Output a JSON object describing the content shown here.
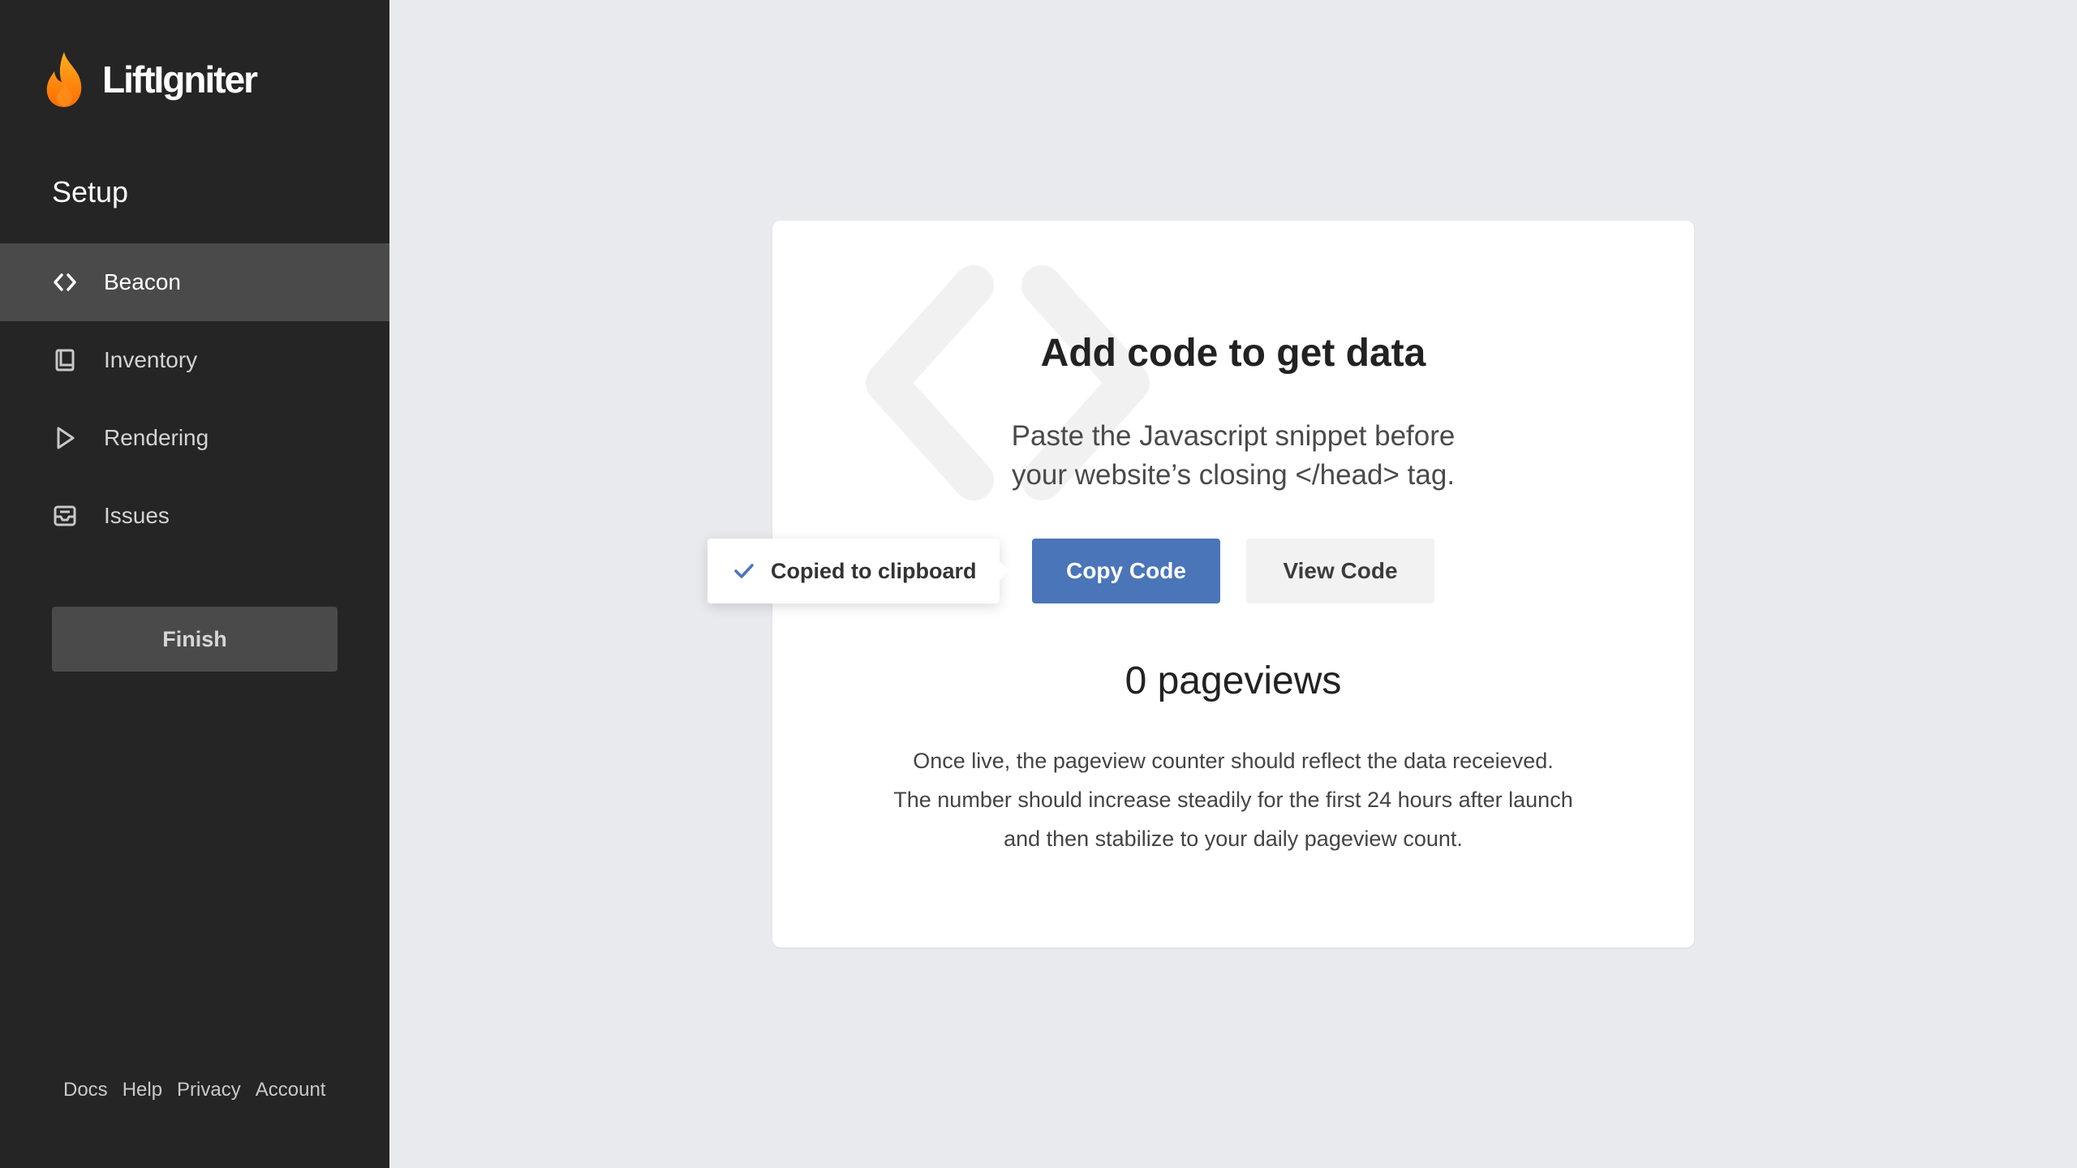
{
  "app": {
    "name": "LiftIgniter",
    "logo_icon": "flame-icon",
    "accent_color": "#4a75b9"
  },
  "sidebar": {
    "section_title": "Setup",
    "items": [
      {
        "label": "Beacon",
        "icon": "code-brackets-icon",
        "active": true
      },
      {
        "label": "Inventory",
        "icon": "book-icon",
        "active": false
      },
      {
        "label": "Rendering",
        "icon": "play-icon",
        "active": false
      },
      {
        "label": "Issues",
        "icon": "inbox-icon",
        "active": false
      }
    ],
    "finish_label": "Finish",
    "footer_links": [
      "Docs",
      "Help",
      "Privacy",
      "Account"
    ]
  },
  "card": {
    "title": "Add code to get data",
    "subtitle_lines": [
      "Paste the Javascript snippet before",
      "your website’s closing </head> tag."
    ],
    "copy_button_label": "Copy Code",
    "view_button_label": "View Code",
    "pageviews_text": "0 pageviews",
    "note_lines": [
      "Once live, the pageview counter should reflect the data receieved.",
      "The number should increase steadily for the first 24 hours after launch",
      "and then stabilize to your daily pageview count."
    ]
  },
  "tooltip": {
    "icon": "checkmark-icon",
    "text": "Copied to clipboard"
  }
}
